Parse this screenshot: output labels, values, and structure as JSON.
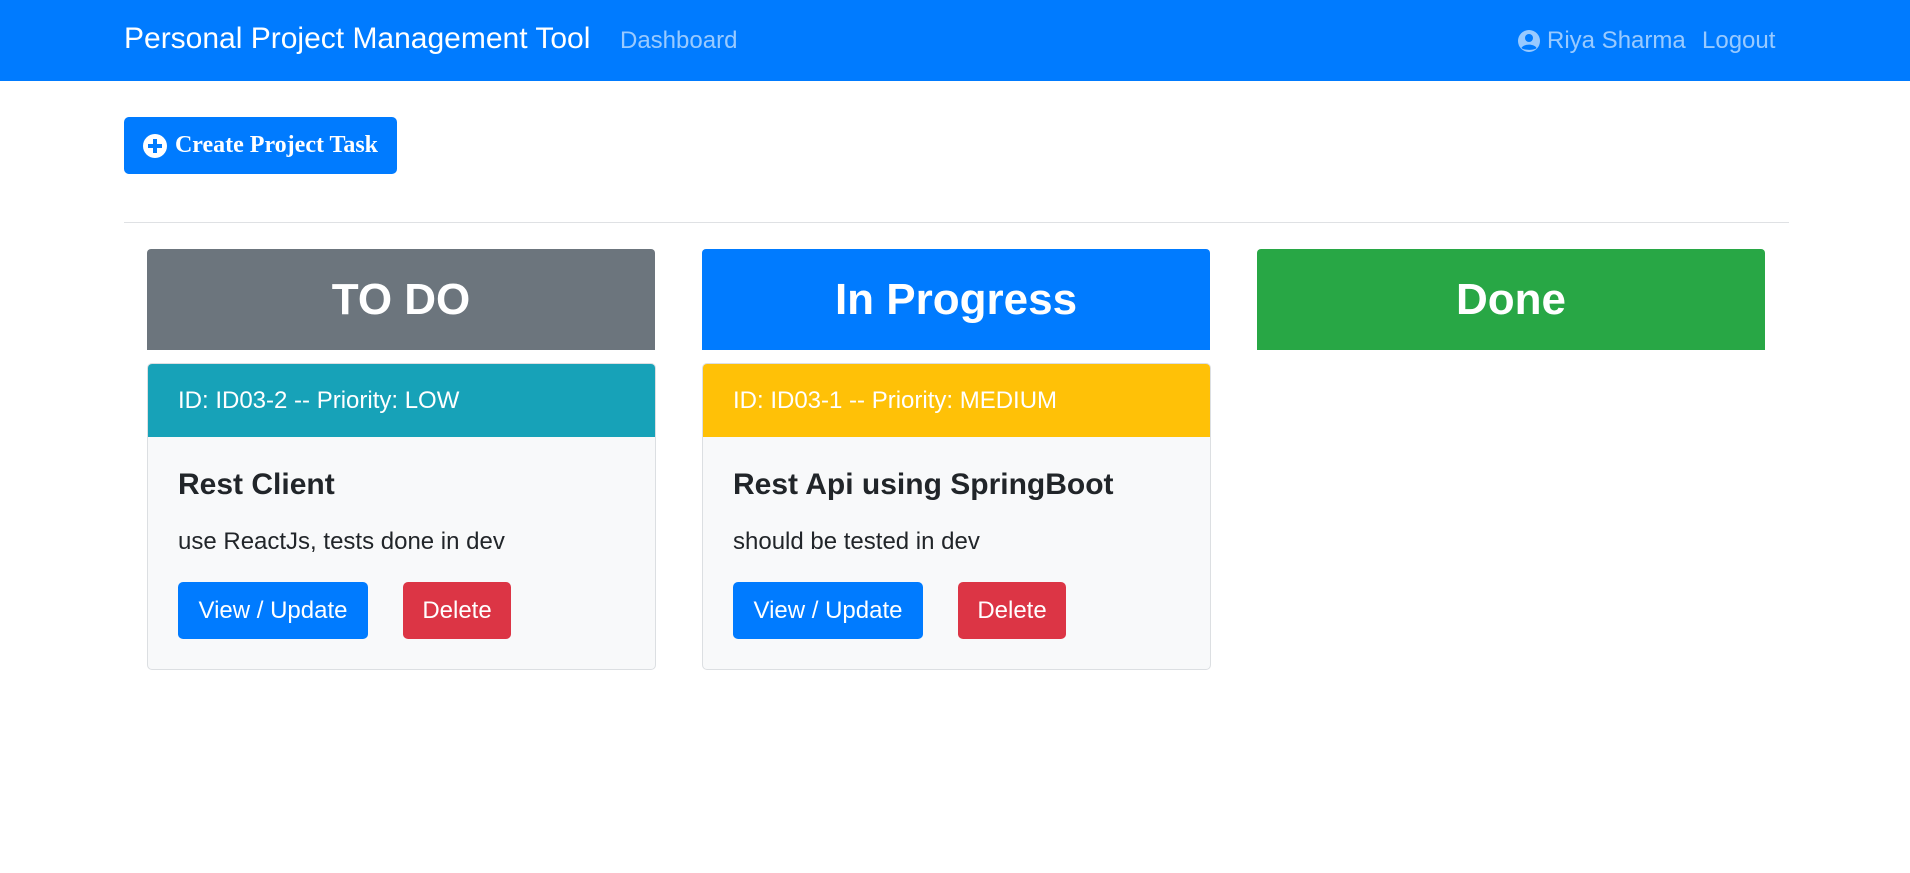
{
  "navbar": {
    "brand": "Personal Project Management Tool",
    "dashboard_label": "Dashboard",
    "user_name": "Riya Sharma",
    "logout_label": "Logout",
    "bg_color": "#007bff"
  },
  "toolbar": {
    "create_label": "Create Project Task"
  },
  "columns": [
    {
      "title": "TO DO",
      "color": "#6c757d"
    },
    {
      "title": "In Progress",
      "color": "#007bff"
    },
    {
      "title": "Done",
      "color": "#28a745"
    }
  ],
  "tasks": [
    {
      "header": "ID: ID03-2 -- Priority: LOW",
      "header_color": "#17a2b8",
      "title": "Rest Client",
      "description": "use ReactJs, tests done in dev",
      "view_label": "View / Update",
      "delete_label": "Delete"
    },
    {
      "header": "ID: ID03-1 -- Priority: MEDIUM",
      "header_color": "#ffc107",
      "title": "Rest Api using SpringBoot",
      "description": "should be tested in dev",
      "view_label": "View / Update",
      "delete_label": "Delete"
    }
  ]
}
